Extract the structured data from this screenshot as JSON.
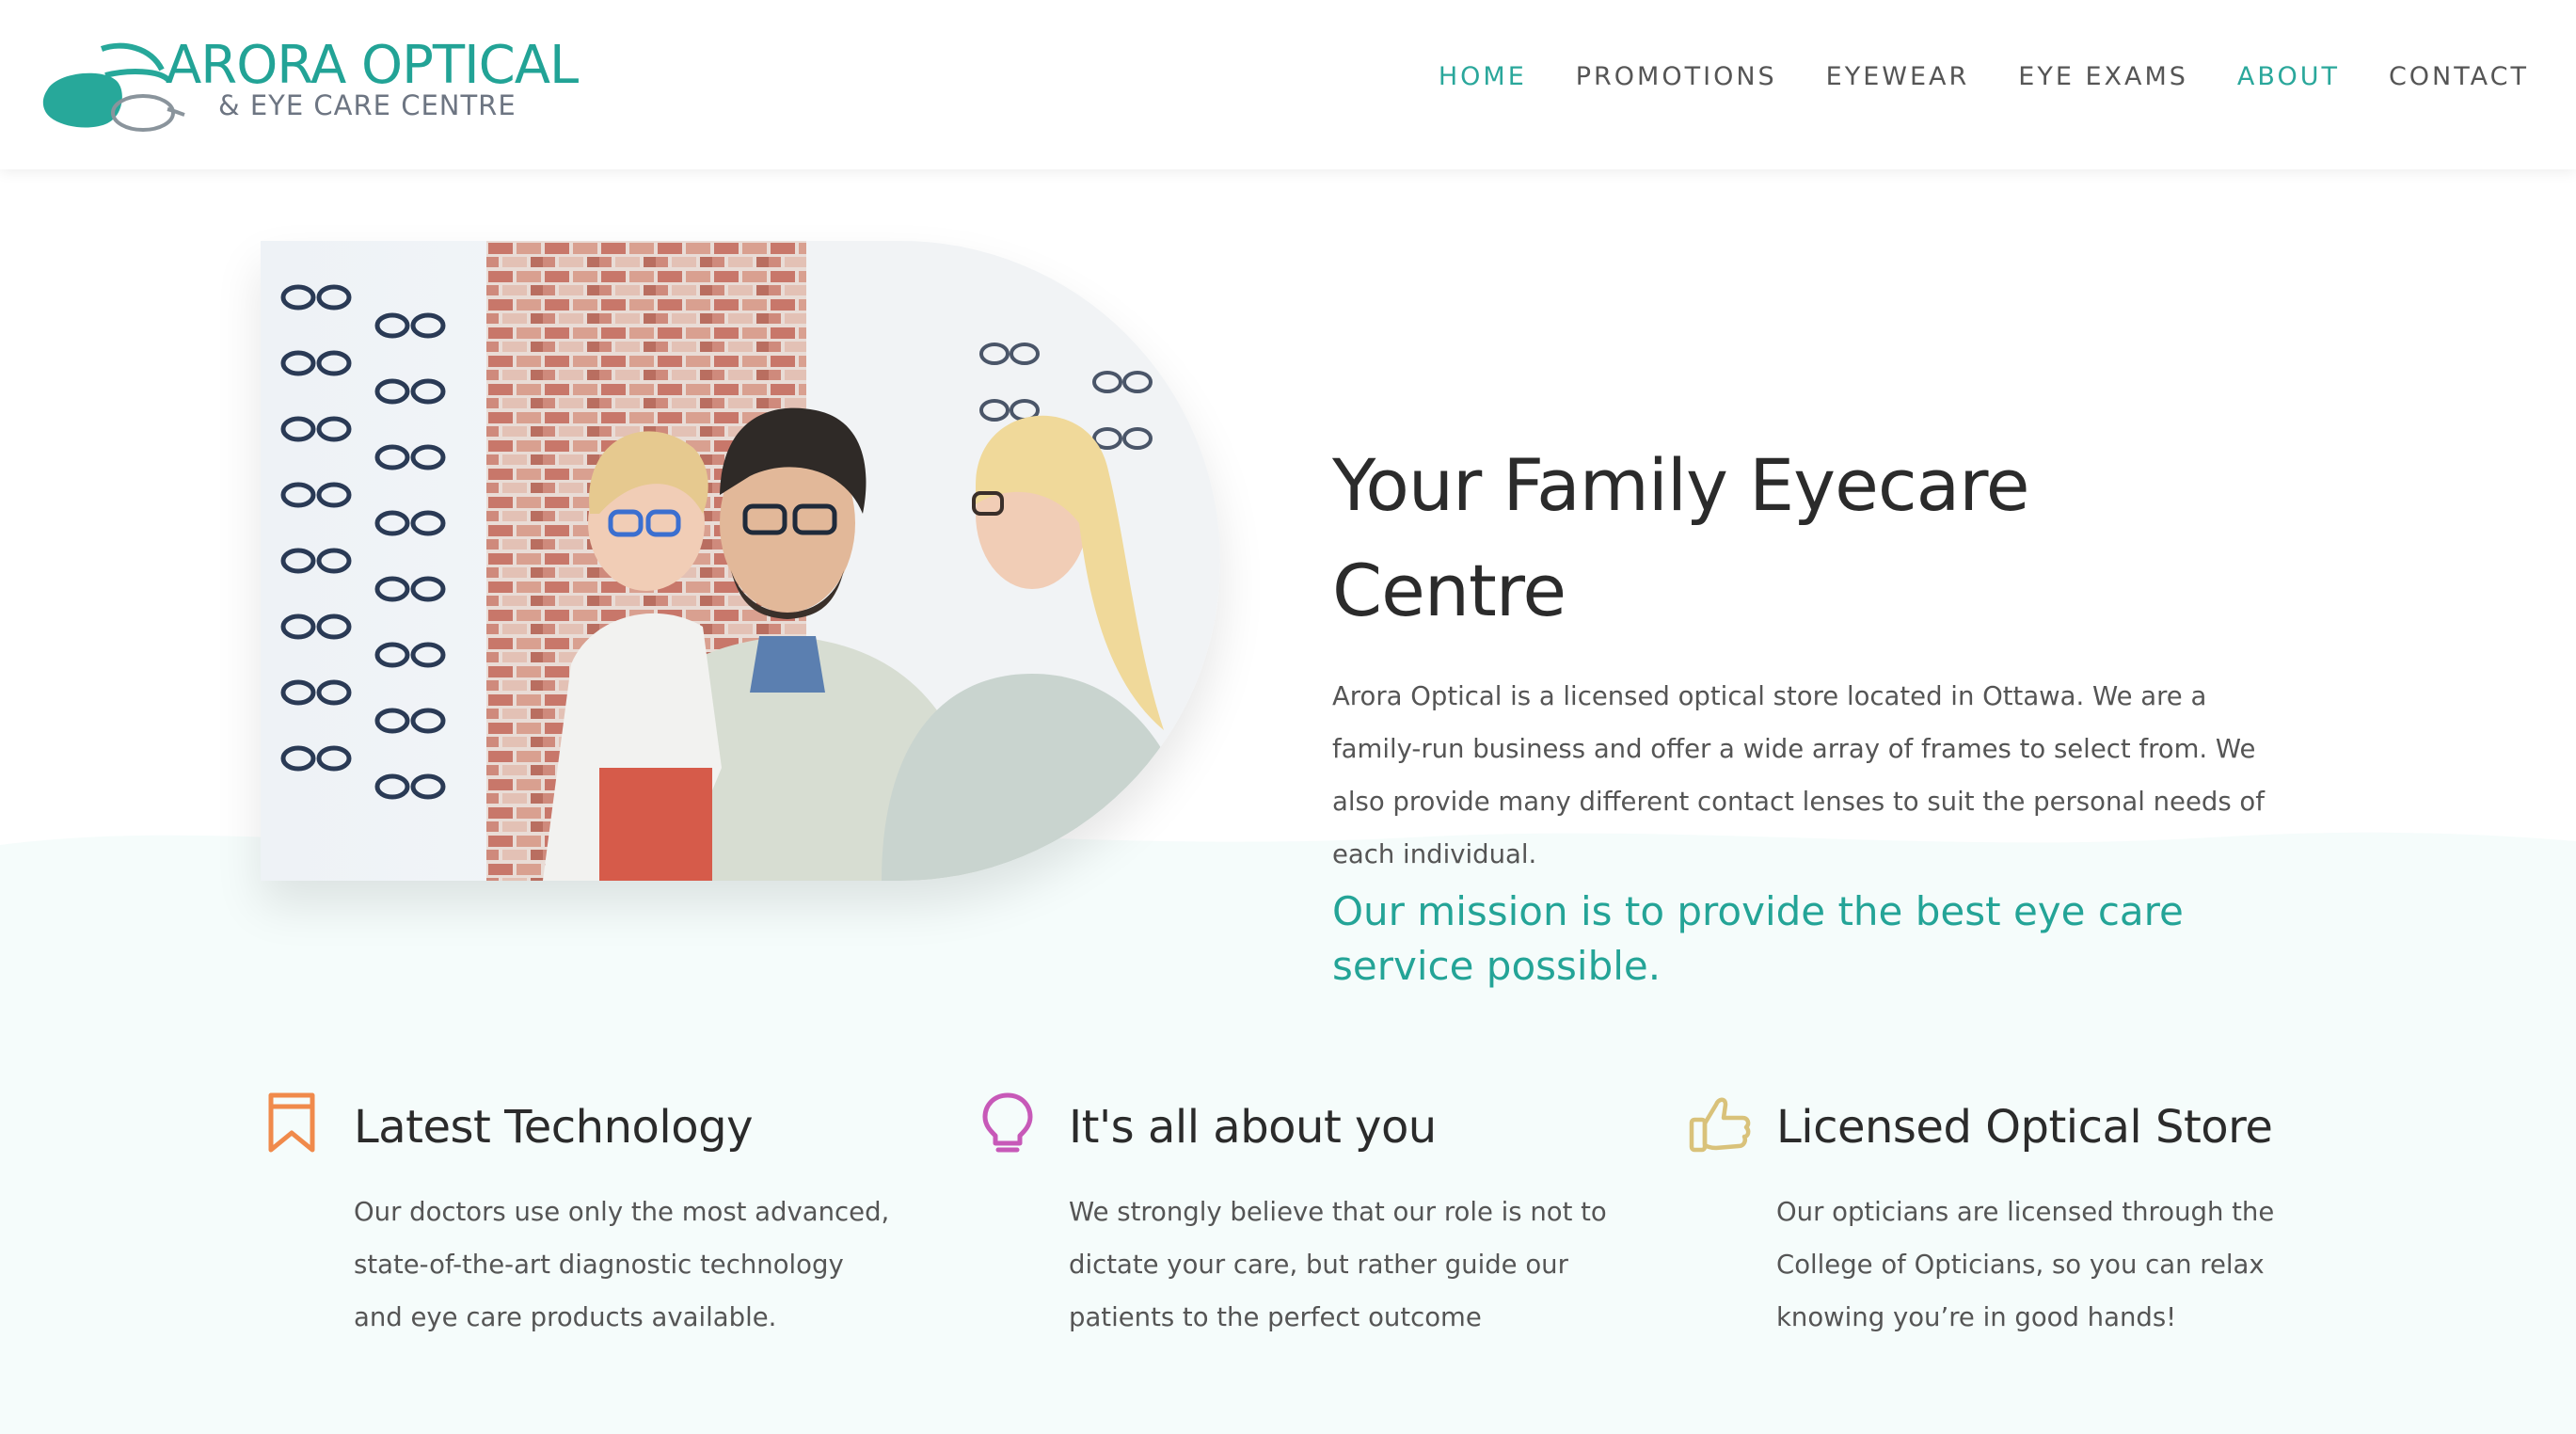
{
  "header": {
    "logo": {
      "title": "ARORA OPTICAL",
      "subtitle": "& EYE CARE CENTRE",
      "icon": "eyeglasses-icon"
    },
    "nav": [
      {
        "label": "HOME",
        "active": true
      },
      {
        "label": "PROMOTIONS",
        "active": false
      },
      {
        "label": "EYEWEAR",
        "active": false
      },
      {
        "label": "EYE EXAMS",
        "active": false
      },
      {
        "label": "ABOUT",
        "active": true
      },
      {
        "label": "CONTACT",
        "active": false
      }
    ]
  },
  "hero": {
    "image": "family-trying-eyeglasses-photo",
    "title_line1": "Your Family Eyecare",
    "title_line2": "Centre",
    "body": "Arora Optical is a licensed optical store located in Ottawa. We are a family-run business and offer a wide array of frames to select from. We also provide many different contact lenses to suit the personal needs of each individual.",
    "mission": "Our mission is to provide the best eye care service possible."
  },
  "features": [
    {
      "icon": "bookmark-icon",
      "title": "Latest Technology",
      "body": "Our doctors use only the most advanced, state-of-the-art diagnostic technology and eye care products available."
    },
    {
      "icon": "lightbulb-icon",
      "title": "It's all about you",
      "body": "We strongly believe that our role is not to dictate your care, but rather guide our patients to the perfect outcome"
    },
    {
      "icon": "thumbs-up-icon",
      "title": "Licensed Optical Store",
      "body": "Our opticians are licensed through the College of Opticians, so you can relax knowing you’re in good hands!"
    }
  ],
  "colors": {
    "accent": "#2aa79b",
    "nav_text": "#555555",
    "bookmark_icon": "#f08a4b",
    "lightbulb_icon": "#c759b8",
    "thumbs_icon": "#d9c27a",
    "section_bg": "#f5fcfb"
  }
}
